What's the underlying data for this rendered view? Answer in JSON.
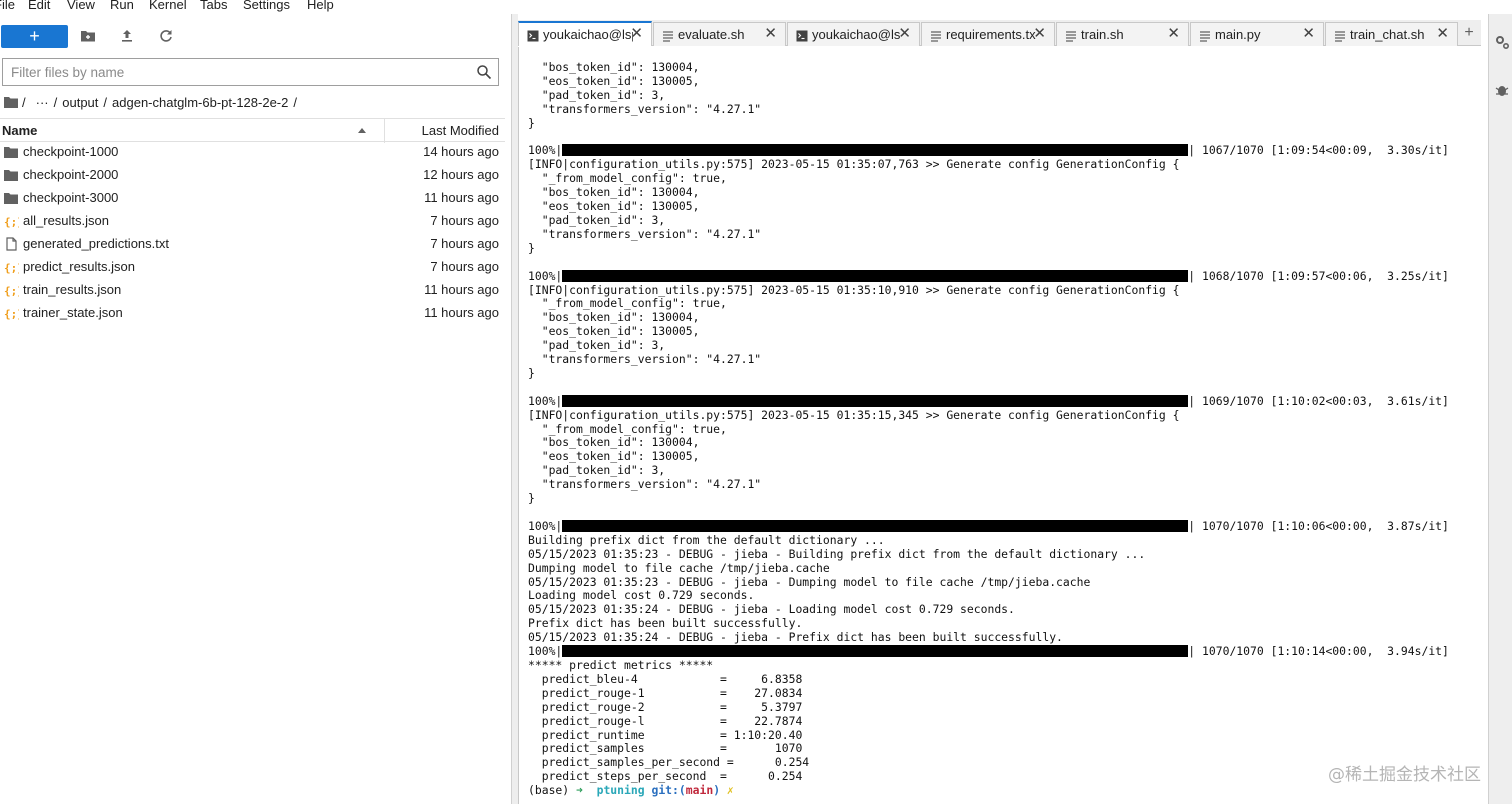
{
  "menubar": {
    "items": [
      "File",
      "Edit",
      "View",
      "Run",
      "Kernel",
      "Tabs",
      "Settings",
      "Help"
    ]
  },
  "filebrowser": {
    "new_button_label": "+",
    "filter_placeholder": "Filter files by name",
    "breadcrumb": {
      "root": "/",
      "ellipsis": "···",
      "parts": [
        "output",
        "adgen-chatglm-6b-pt-128-2e-2"
      ],
      "sep": "/"
    },
    "columns": {
      "name": "Name",
      "modified": "Last Modified"
    },
    "files": [
      {
        "name": "checkpoint-1000",
        "type": "folder",
        "modified": "14 hours ago"
      },
      {
        "name": "checkpoint-2000",
        "type": "folder",
        "modified": "12 hours ago"
      },
      {
        "name": "checkpoint-3000",
        "type": "folder",
        "modified": "11 hours ago"
      },
      {
        "name": "all_results.json",
        "type": "json",
        "modified": "7 hours ago"
      },
      {
        "name": "generated_predictions.txt",
        "type": "text",
        "modified": "7 hours ago"
      },
      {
        "name": "predict_results.json",
        "type": "json",
        "modified": "7 hours ago"
      },
      {
        "name": "train_results.json",
        "type": "json",
        "modified": "11 hours ago"
      },
      {
        "name": "trainer_state.json",
        "type": "json",
        "modified": "11 hours ago"
      }
    ]
  },
  "tabs": [
    {
      "label": "youkaichao@lsp",
      "icon": "terminal-icon",
      "active": true
    },
    {
      "label": "evaluate.sh",
      "icon": "text-file-icon",
      "active": false
    },
    {
      "label": "youkaichao@lsp",
      "icon": "terminal-icon",
      "active": false
    },
    {
      "label": "requirements.tx",
      "icon": "text-file-icon",
      "active": false
    },
    {
      "label": "train.sh",
      "icon": "text-file-icon",
      "active": false
    },
    {
      "label": "main.py",
      "icon": "text-file-icon",
      "active": false
    },
    {
      "label": "train_chat.sh",
      "icon": "text-file-icon",
      "active": false
    }
  ],
  "add_tab_label": "+",
  "terminal": {
    "config_close": [
      "  \"bos_token_id\": 130004,",
      "  \"eos_token_id\": 130005,",
      "  \"pad_token_id\": 3,",
      "  \"transformers_version\": \"4.27.1\"",
      "}"
    ],
    "progress_blocks": [
      {
        "pct": "100%|",
        "right": "| 1067/1070 [1:09:54<00:09,  3.30s/it]",
        "info": "[INFO|configuration_utils.py:575] 2023-05-15 01:35:07,763 >> Generate config GenerationConfig {"
      },
      {
        "pct": "100%|",
        "right": "| 1068/1070 [1:09:57<00:06,  3.25s/it]",
        "info": "[INFO|configuration_utils.py:575] 2023-05-15 01:35:10,910 >> Generate config GenerationConfig {"
      },
      {
        "pct": "100%|",
        "right": "| 1069/1070 [1:10:02<00:03,  3.61s/it]",
        "info": "[INFO|configuration_utils.py:575] 2023-05-15 01:35:15,345 >> Generate config GenerationConfig {"
      }
    ],
    "config_body": [
      "  \"_from_model_config\": true,",
      "  \"bos_token_id\": 130004,",
      "  \"eos_token_id\": 130005,",
      "  \"pad_token_id\": 3,",
      "  \"transformers_version\": \"4.27.1\"",
      "}"
    ],
    "final_progress_1": {
      "pct": "100%|",
      "right": "| 1070/1070 [1:10:06<00:00,  3.87s/it]"
    },
    "jieba_lines": [
      "Building prefix dict from the default dictionary ...",
      "05/15/2023 01:35:23 - DEBUG - jieba - Building prefix dict from the default dictionary ...",
      "Dumping model to file cache /tmp/jieba.cache",
      "05/15/2023 01:35:23 - DEBUG - jieba - Dumping model to file cache /tmp/jieba.cache",
      "Loading model cost 0.729 seconds.",
      "05/15/2023 01:35:24 - DEBUG - jieba - Loading model cost 0.729 seconds.",
      "Prefix dict has been built successfully.",
      "05/15/2023 01:35:24 - DEBUG - jieba - Prefix dict has been built successfully."
    ],
    "final_progress_2": {
      "pct": "100%|",
      "right": "| 1070/1070 [1:10:14<00:00,  3.94s/it]"
    },
    "metrics_header": "***** predict metrics *****",
    "metrics": [
      "  predict_bleu-4            =     6.8358",
      "  predict_rouge-1           =    27.0834",
      "  predict_rouge-2           =     5.3797",
      "  predict_rouge-l           =    22.7874",
      "  predict_runtime           = 1:10:20.40",
      "  predict_samples           =       1070",
      "  predict_samples_per_second =      0.254",
      "  predict_steps_per_second  =      0.254"
    ],
    "prompt": {
      "env": "(base) ",
      "arrow": "➜",
      "dir": "ptuning",
      "git": "git:(",
      "branch": "main",
      "git_close": ")",
      "dirty": "✗"
    }
  },
  "watermark": "@稀土掘金技术社区",
  "colors": {
    "accent": "#1976d2",
    "json_icon": "#f0a020"
  }
}
